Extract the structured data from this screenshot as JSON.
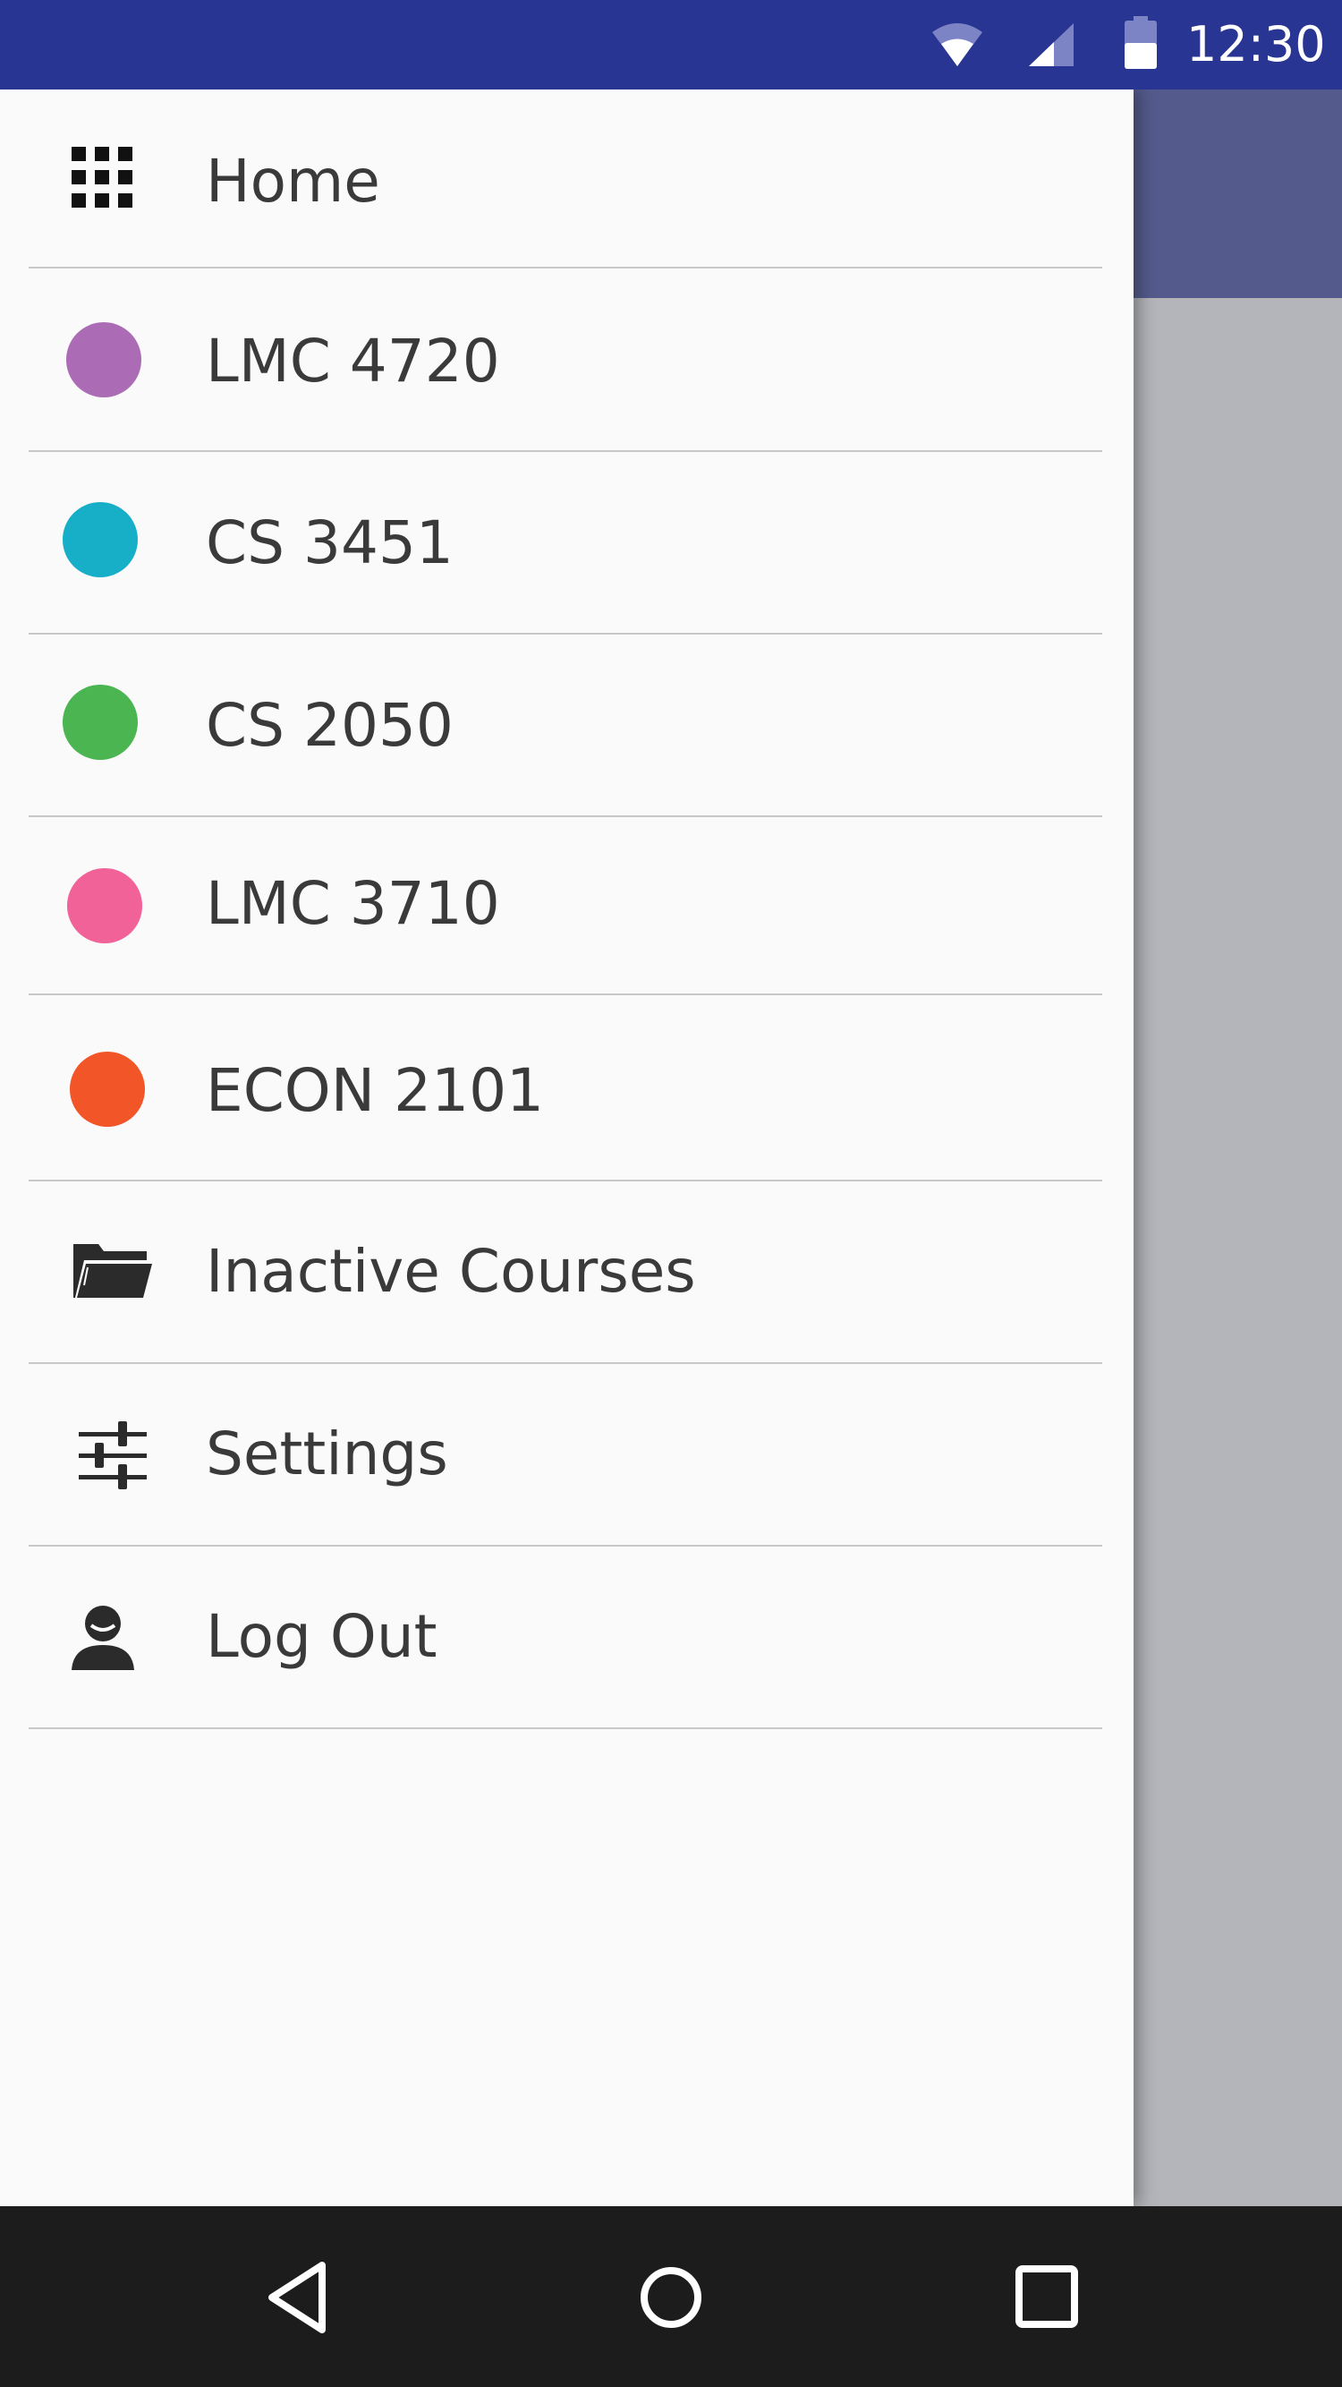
{
  "status_bar": {
    "time": "12:30",
    "background": "#283593"
  },
  "drawer": {
    "items": [
      {
        "label": "Home",
        "icon": "grid-icon"
      },
      {
        "label": "LMC 4720",
        "icon": "course-dot-icon",
        "color": "#ab6bb5"
      },
      {
        "label": "CS 3451",
        "icon": "course-dot-icon",
        "color": "#17afc8"
      },
      {
        "label": "CS 2050",
        "icon": "course-dot-icon",
        "color": "#4bb551"
      },
      {
        "label": "LMC 3710",
        "icon": "course-dot-icon",
        "color": "#f06298"
      },
      {
        "label": "ECON 2101",
        "icon": "course-dot-icon",
        "color": "#f25527"
      },
      {
        "label": "Inactive Courses",
        "icon": "folder-icon"
      },
      {
        "label": "Settings",
        "icon": "sliders-icon"
      },
      {
        "label": "Log Out",
        "icon": "person-icon"
      }
    ]
  },
  "nav_bar": {
    "buttons": [
      "back-icon",
      "home-icon",
      "recents-icon"
    ]
  }
}
